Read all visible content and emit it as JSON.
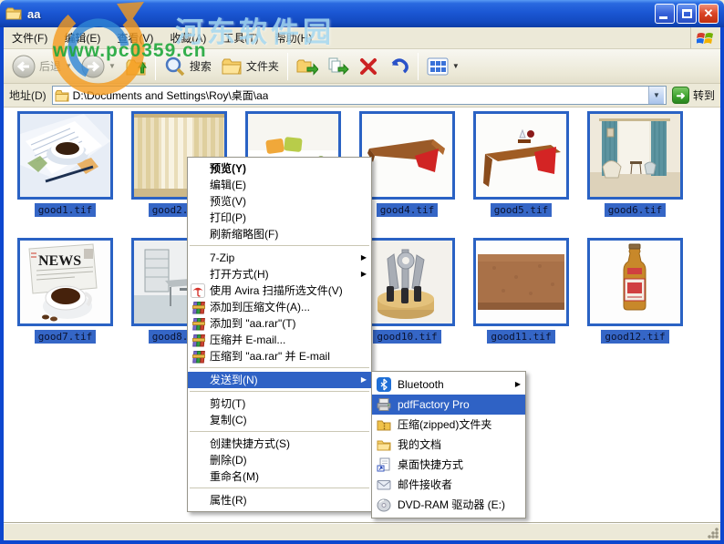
{
  "window": {
    "title": "aa"
  },
  "watermark": {
    "site_name": "河东软件园",
    "site_url": "www.pc0359.cn"
  },
  "menubar": {
    "items": [
      {
        "label": "文件(F)"
      },
      {
        "label": "编辑(E)"
      },
      {
        "label": "查看(V)"
      },
      {
        "label": "收藏(A)"
      },
      {
        "label": "工具(T)"
      },
      {
        "label": "帮助(H)"
      }
    ]
  },
  "toolbar": {
    "back_label": "后退",
    "search_label": "搜索",
    "folders_label": "文件夹"
  },
  "addressbar": {
    "label": "地址(D)",
    "value": "D:\\Documents and Settings\\Roy\\桌面\\aa",
    "go_label": "转到"
  },
  "files": [
    {
      "name": "good1.tif"
    },
    {
      "name": "good2.tif"
    },
    {
      "name": ""
    },
    {
      "name": "good4.tif"
    },
    {
      "name": "good5.tif"
    },
    {
      "name": "good6.tif"
    },
    {
      "name": "good7.tif"
    },
    {
      "name": "good8.tif"
    },
    {
      "name": "good10.tif"
    },
    {
      "name": "good11.tif"
    },
    {
      "name": "good12.tif"
    }
  ],
  "context_menu": {
    "items": [
      {
        "label": "预览(Y)",
        "bold": true
      },
      {
        "label": "编辑(E)"
      },
      {
        "label": "预览(V)"
      },
      {
        "label": "打印(P)"
      },
      {
        "label": "刷新缩略图(F)"
      },
      {
        "type": "separator"
      },
      {
        "label": "7-Zip",
        "arrow": true
      },
      {
        "label": "打开方式(H)",
        "arrow": true
      },
      {
        "label": "使用 Avira 扫描所选文件(V)",
        "icon": "avira"
      },
      {
        "label": "添加到压缩文件(A)...",
        "icon": "winrar"
      },
      {
        "label": "添加到 \"aa.rar\"(T)",
        "icon": "winrar"
      },
      {
        "label": "压缩并 E-mail...",
        "icon": "winrar"
      },
      {
        "label": "压缩到 \"aa.rar\" 并 E-mail",
        "icon": "winrar"
      },
      {
        "type": "separator"
      },
      {
        "label": "发送到(N)",
        "arrow": true,
        "selected": true
      },
      {
        "type": "separator"
      },
      {
        "label": "剪切(T)"
      },
      {
        "label": "复制(C)"
      },
      {
        "type": "separator"
      },
      {
        "label": "创建快捷方式(S)"
      },
      {
        "label": "删除(D)"
      },
      {
        "label": "重命名(M)"
      },
      {
        "type": "separator"
      },
      {
        "label": "属性(R)"
      }
    ]
  },
  "send_to_menu": {
    "items": [
      {
        "label": "Bluetooth",
        "icon": "bluetooth",
        "arrow": true
      },
      {
        "label": "pdfFactory Pro",
        "icon": "printer",
        "selected": true
      },
      {
        "label": "压缩(zipped)文件夹",
        "icon": "zipfolder"
      },
      {
        "label": "我的文档",
        "icon": "folder"
      },
      {
        "label": "桌面快捷方式",
        "icon": "shortcut"
      },
      {
        "label": "邮件接收者",
        "icon": "mail"
      },
      {
        "label": "DVD-RAM 驱动器 (E:)",
        "icon": "dvd"
      }
    ]
  }
}
